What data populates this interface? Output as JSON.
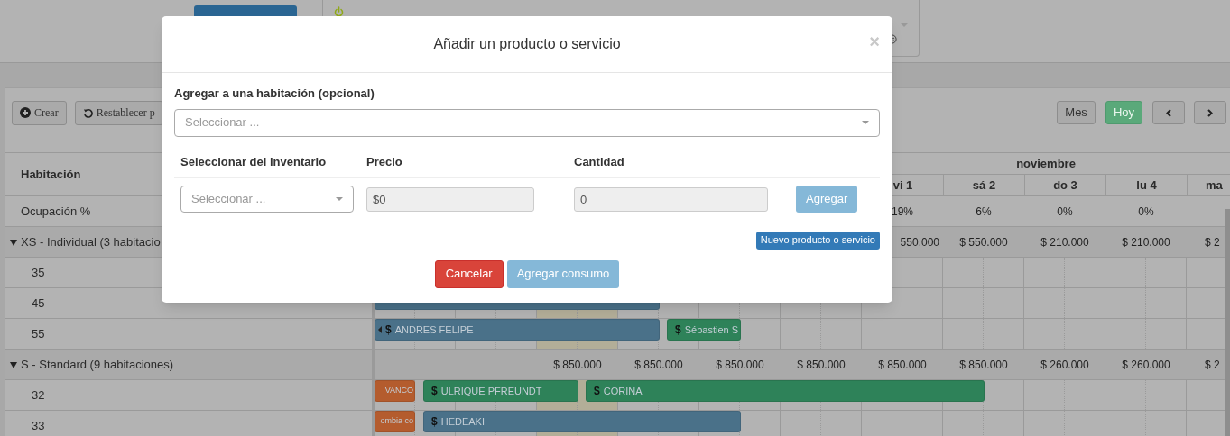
{
  "toolbar": {
    "actions": [
      {
        "kind": "create",
        "label": "Crear"
      },
      {
        "kind": "reset",
        "label": "Restablecer p"
      }
    ],
    "view_buttons": [
      {
        "label": "Mes",
        "selected": false
      },
      {
        "label": "Hoy",
        "selected": true
      }
    ]
  },
  "table": {
    "room_header": "Habitación",
    "month": "noviembre",
    "days": [
      "vi 1",
      "sá 2",
      "do 3",
      "lu 4",
      "ma"
    ],
    "occupancy": {
      "label": "Ocupación %",
      "values": [
        "19%",
        "6%",
        "0%",
        "0%"
      ]
    },
    "groups": [
      {
        "name": "XS - Individual (3 habitacio",
        "expanded": true,
        "first_price": "550.000",
        "prices": [
          "$ 550.000",
          "$ 210.000",
          "$ 210.000",
          "$ 2"
        ],
        "rooms": [
          {
            "number": "35"
          },
          {
            "number": "45",
            "bookings": [
              {
                "color": "#4a7189"
              }
            ]
          },
          {
            "number": "55",
            "bookings": [
              {
                "mark": "$",
                "label": "ANDRES FELIPE",
                "color": "#4a7189",
                "cut_left": true
              },
              {
                "mark": "$",
                "label": "Sébastien S",
                "color": "#2e8259",
                "cut_left": false
              }
            ]
          }
        ]
      },
      {
        "name": "S - Standard (9 habitaciones)",
        "expanded": true,
        "prices": [
          "$ 850.000",
          "$ 850.000",
          "$ 850.000",
          "$ 850.000",
          "$ 850.000",
          "$ 850.000",
          "$ 260.000",
          "$ 260.000",
          "$ 2"
        ],
        "rooms": [
          {
            "number": "32",
            "bookings": [
              {
                "label": "VANCO",
                "color": "#b45c2e",
                "cut_left": false
              },
              {
                "mark": "$",
                "label": "ULRIQUE PFREUNDT",
                "color": "#2e8259",
                "cut_left": false
              },
              {
                "mark": "$",
                "label": "CORINA",
                "color": "#2e8259",
                "cut_left": false
              }
            ]
          },
          {
            "number": "33",
            "bookings": [
              {
                "label": "ombia co",
                "color": "#b45c2e",
                "cut_left": false
              },
              {
                "mark": "$",
                "label": "HEDEAKI",
                "color": "#4a7189",
                "cut_left": false
              }
            ]
          }
        ]
      }
    ]
  },
  "modal": {
    "title": "Añadir un producto o servicio",
    "close": "×",
    "room_label": "Agregar a una habitación (opcional)",
    "room_select": {
      "placeholder": "Seleccionar ..."
    },
    "columns": [
      "Seleccionar del inventario",
      "Precio",
      "Cantidad"
    ],
    "item_select": {
      "placeholder": "Seleccionar ..."
    },
    "price": {
      "value": "$0"
    },
    "quantity": {
      "value": "0"
    },
    "add_button": {
      "label": "Agregar",
      "disabled": true
    },
    "new_product_button": "Nuevo producto o servicio",
    "cancel_button": "Cancelar",
    "submit_button": {
      "label": "Agregar consumo",
      "disabled": true
    }
  }
}
